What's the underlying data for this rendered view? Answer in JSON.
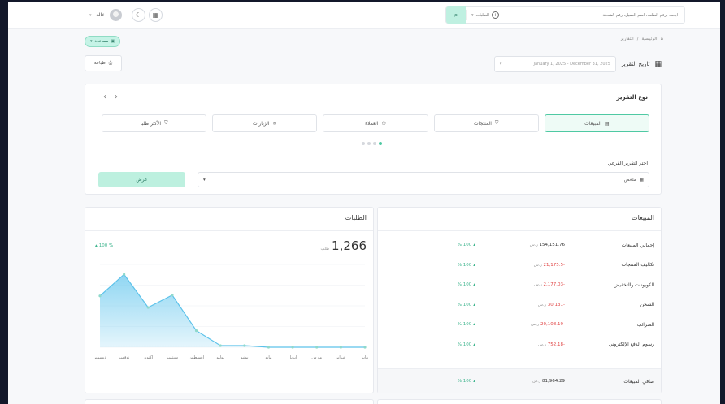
{
  "header": {
    "user_name": "خالد",
    "search_placeholder": "ابحث برقم الطلب، اسم العميل، رقم الشحنة",
    "search_scope": "الطلبات",
    "search_button_icon": "search-icon"
  },
  "help_button": {
    "label": "مساعدة"
  },
  "breadcrumb": {
    "home": "الرئيسية",
    "current": "التقارير"
  },
  "print_button": {
    "label": "طباعة"
  },
  "date_range": {
    "label": "تاريخ التقرير",
    "value": "January 1, 2025 - December 31, 2025"
  },
  "report_types": {
    "title": "نوع التقرير",
    "tabs": [
      {
        "label": "المبيعات",
        "icon": "file-chart-icon",
        "active": true
      },
      {
        "label": "المنتجات",
        "icon": "shirt-icon",
        "active": false
      },
      {
        "label": "العملاء",
        "icon": "users-icon",
        "active": false
      },
      {
        "label": "الزيارات",
        "icon": "link-icon",
        "active": false
      },
      {
        "label": "الأكثر طلبا",
        "icon": "shirt-icon",
        "active": false
      }
    ],
    "sub_label": "اختر التقرير الفرعي",
    "sub_value": "ملخص",
    "view_button": "عرض"
  },
  "orders": {
    "title": "الطلبات",
    "total": "1,266",
    "unit": "طلب",
    "pct": "100 %",
    "accent": "#7ccff0"
  },
  "chart_data": {
    "type": "area",
    "categories": [
      "يناير",
      "فبراير",
      "مارس",
      "أبريل",
      "مايو",
      "يونيو",
      "يوليو",
      "أغسطس",
      "سبتمبر",
      "أكتوبر",
      "نوفمبر",
      "ديسمبر"
    ],
    "series": [
      {
        "values": [
          0,
          0,
          0,
          0,
          0,
          2,
          2,
          20,
          63,
          48,
          88,
          62
        ]
      }
    ],
    "ylim": [
      0,
      100
    ],
    "grid": true
  },
  "sales": {
    "title": "المبيعات",
    "rows": [
      {
        "label": "إجمالي المبيعات",
        "value": "154,151.76",
        "currency": "ر.س",
        "negative": false,
        "pct": "100 %"
      },
      {
        "label": "تكاليف المنتجات",
        "value": "-21,175.5",
        "currency": "ر.س",
        "negative": true,
        "pct": "100 %"
      },
      {
        "label": "الكوبونات والتخفيض",
        "value": "-2,177.03",
        "currency": "ر.س",
        "negative": true,
        "pct": "100 %"
      },
      {
        "label": "الشحن",
        "value": "-30,131",
        "currency": "ر.س",
        "negative": true,
        "pct": "100 %"
      },
      {
        "label": "الضرائب",
        "value": "-20,108.19",
        "currency": "ر.س",
        "negative": true,
        "pct": "100 %"
      },
      {
        "label": "رسوم الدفع الإلكتروني",
        "value": "-752.18",
        "currency": "ر.س",
        "negative": true,
        "pct": "100 %"
      }
    ],
    "net": {
      "label": "صافي المبيعات",
      "value": "81,964.29",
      "currency": "ر.س",
      "pct": "100 %"
    }
  }
}
